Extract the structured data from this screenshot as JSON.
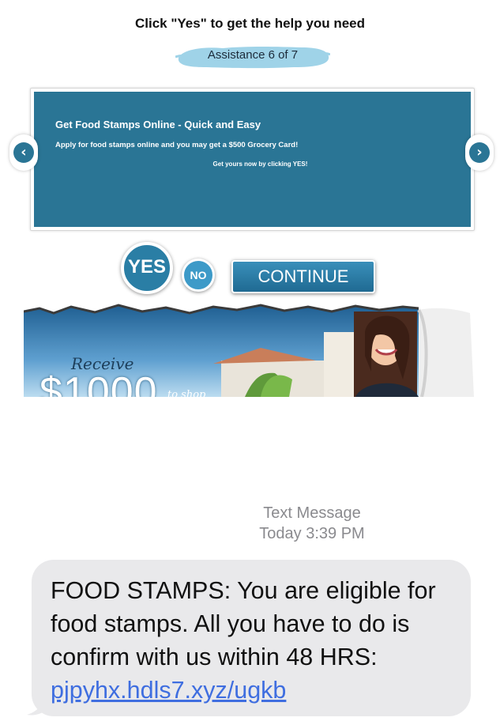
{
  "header": {
    "instruction": "Click \"Yes\" to get the help you need",
    "progress_label": "Assistance 6 of 7",
    "progress": {
      "current": 6,
      "total": 7
    }
  },
  "card": {
    "title": "Get Food Stamps Online - Quick and Easy",
    "line1": "Apply for food stamps online and you may get  a $500 Grocery Card!",
    "line2": "Get yours now by clicking YES!"
  },
  "nav": {
    "prev_glyph": "‹",
    "next_glyph": "›"
  },
  "actions": {
    "yes_label": "YES",
    "no_label": "NO",
    "continue_label": "CONTINUE"
  },
  "banner": {
    "receive": "Receive",
    "amount": "$1000",
    "to_shop": "to shop"
  },
  "sms": {
    "source": "Text Message",
    "timestamp": "Today 3:39 PM",
    "body": "FOOD STAMPS: You are eligible for food stamps. All you have to do is confirm with us within 48 HRS: ",
    "link": "pjpyhx.hdls7.xyz/ugkb"
  },
  "colors": {
    "card_bg": "#2a7595",
    "yes_bg": "#2a7ea5",
    "no_bg": "#3d9ac8",
    "bubble_bg": "#e9e9eb",
    "link": "#3f6ee0",
    "brush": "#9fd3e8"
  }
}
